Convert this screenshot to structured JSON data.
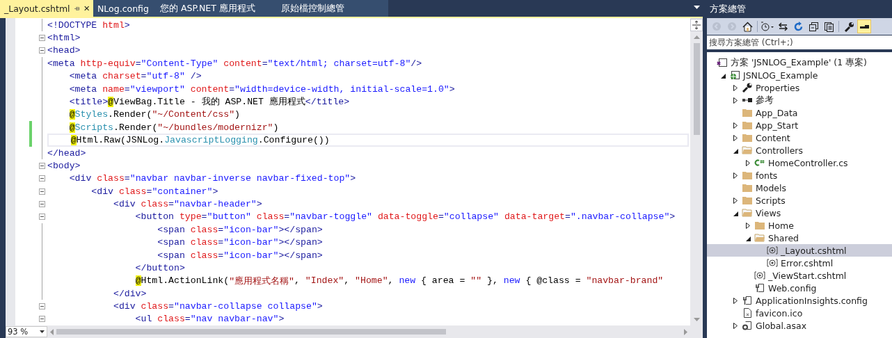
{
  "editor": {
    "tabs": [
      {
        "label": "_Layout.cshtml",
        "selected": true
      },
      {
        "label": "NLog.config",
        "selected": false
      },
      {
        "label": "您的 ASP.NET 應用程式",
        "selected": false
      },
      {
        "label": "原始檔控制總管",
        "selected": false
      }
    ],
    "lines": [
      {
        "fold": false,
        "changed": false,
        "current": false,
        "tokens": [
          {
            "kind": "tag",
            "text": "<!DOCTYPE"
          },
          {
            "kind": "attr",
            "text": " html"
          },
          {
            "kind": "tag",
            "text": ">"
          }
        ]
      },
      {
        "fold": true,
        "changed": false,
        "current": false,
        "tokens": [
          {
            "kind": "tag",
            "text": "<html>"
          }
        ]
      },
      {
        "fold": true,
        "changed": false,
        "current": false,
        "tokens": [
          {
            "kind": "tag",
            "text": "<head>"
          }
        ]
      },
      {
        "fold": false,
        "changed": false,
        "current": false,
        "tokens": [
          {
            "kind": "tag",
            "text": "<meta"
          },
          {
            "kind": "attr",
            "text": " http-equiv"
          },
          {
            "kind": "tag",
            "text": "="
          },
          {
            "kind": "value",
            "text": "\"Content-Type\""
          },
          {
            "kind": "attr",
            "text": " content"
          },
          {
            "kind": "tag",
            "text": "="
          },
          {
            "kind": "value",
            "text": "\"text/html; charset=utf-8\""
          },
          {
            "kind": "tag",
            "text": "/>"
          }
        ]
      },
      {
        "fold": false,
        "changed": false,
        "current": false,
        "tokens": [
          {
            "kind": "tag",
            "text": "    <meta"
          },
          {
            "kind": "attr",
            "text": " charset"
          },
          {
            "kind": "tag",
            "text": "="
          },
          {
            "kind": "value",
            "text": "\"utf-8\""
          },
          {
            "kind": "tag",
            "text": " />"
          }
        ]
      },
      {
        "fold": false,
        "changed": false,
        "current": false,
        "tokens": [
          {
            "kind": "tag",
            "text": "    <meta"
          },
          {
            "kind": "attr",
            "text": " name"
          },
          {
            "kind": "tag",
            "text": "="
          },
          {
            "kind": "value",
            "text": "\"viewport\""
          },
          {
            "kind": "attr",
            "text": " content"
          },
          {
            "kind": "tag",
            "text": "="
          },
          {
            "kind": "value",
            "text": "\"width=device-width, initial-scale=1.0\""
          },
          {
            "kind": "tag",
            "text": ">"
          }
        ]
      },
      {
        "fold": false,
        "changed": false,
        "current": false,
        "tokens": [
          {
            "kind": "tag",
            "text": "    <title>"
          },
          {
            "kind": "at",
            "text": "@"
          },
          {
            "kind": "text",
            "text": "ViewBag.Title"
          },
          {
            "kind": "text",
            "text": " - 我的 ASP.NET 應用程式"
          },
          {
            "kind": "tag",
            "text": "</title>"
          }
        ]
      },
      {
        "fold": false,
        "changed": false,
        "current": false,
        "tokens": [
          {
            "kind": "at",
            "text": "    @"
          },
          {
            "kind": "type",
            "text": "Styles"
          },
          {
            "kind": "text",
            "text": ".Render("
          },
          {
            "kind": "string",
            "text": "\"~/Content/css\""
          },
          {
            "kind": "text",
            "text": ")"
          }
        ]
      },
      {
        "fold": false,
        "changed": true,
        "current": false,
        "tokens": [
          {
            "kind": "at",
            "text": "    @"
          },
          {
            "kind": "type",
            "text": "Scripts"
          },
          {
            "kind": "text",
            "text": ".Render("
          },
          {
            "kind": "string",
            "text": "\"~/bundles/modernizr\""
          },
          {
            "kind": "text",
            "text": ")"
          }
        ]
      },
      {
        "fold": false,
        "changed": true,
        "current": true,
        "tokens": [
          {
            "kind": "at",
            "text": "    @"
          },
          {
            "kind": "text",
            "text": "Html.Raw(JSNLog."
          },
          {
            "kind": "type",
            "text": "JavascriptLogging"
          },
          {
            "kind": "text",
            "text": ".Configure())"
          }
        ]
      },
      {
        "fold": false,
        "changed": false,
        "current": false,
        "tokens": [
          {
            "kind": "tag",
            "text": "</head>"
          }
        ]
      },
      {
        "fold": true,
        "changed": false,
        "current": false,
        "tokens": [
          {
            "kind": "tag",
            "text": "<body>"
          }
        ]
      },
      {
        "fold": true,
        "changed": false,
        "current": false,
        "tokens": [
          {
            "kind": "tag",
            "text": "    <div"
          },
          {
            "kind": "attr",
            "text": " class"
          },
          {
            "kind": "tag",
            "text": "="
          },
          {
            "kind": "value",
            "text": "\"navbar navbar-inverse navbar-fixed-top\""
          },
          {
            "kind": "tag",
            "text": ">"
          }
        ]
      },
      {
        "fold": true,
        "changed": false,
        "current": false,
        "tokens": [
          {
            "kind": "tag",
            "text": "        <div"
          },
          {
            "kind": "attr",
            "text": " class"
          },
          {
            "kind": "tag",
            "text": "="
          },
          {
            "kind": "value",
            "text": "\"container\""
          },
          {
            "kind": "tag",
            "text": ">"
          }
        ]
      },
      {
        "fold": true,
        "changed": false,
        "current": false,
        "tokens": [
          {
            "kind": "tag",
            "text": "            <div"
          },
          {
            "kind": "attr",
            "text": " class"
          },
          {
            "kind": "tag",
            "text": "="
          },
          {
            "kind": "value",
            "text": "\"navbar-header\""
          },
          {
            "kind": "tag",
            "text": ">"
          }
        ]
      },
      {
        "fold": true,
        "changed": false,
        "current": false,
        "tokens": [
          {
            "kind": "tag",
            "text": "                <button"
          },
          {
            "kind": "attr",
            "text": " type"
          },
          {
            "kind": "tag",
            "text": "="
          },
          {
            "kind": "value",
            "text": "\"button\""
          },
          {
            "kind": "attr",
            "text": " class"
          },
          {
            "kind": "tag",
            "text": "="
          },
          {
            "kind": "value",
            "text": "\"navbar-toggle\""
          },
          {
            "kind": "attr",
            "text": " data-toggle"
          },
          {
            "kind": "tag",
            "text": "="
          },
          {
            "kind": "value",
            "text": "\"collapse\""
          },
          {
            "kind": "attr",
            "text": " data-target"
          },
          {
            "kind": "tag",
            "text": "="
          },
          {
            "kind": "value",
            "text": "\".navbar-collapse\""
          },
          {
            "kind": "tag",
            "text": ">"
          }
        ]
      },
      {
        "fold": false,
        "changed": false,
        "current": false,
        "tokens": [
          {
            "kind": "tag",
            "text": "                    <span"
          },
          {
            "kind": "attr",
            "text": " class"
          },
          {
            "kind": "tag",
            "text": "="
          },
          {
            "kind": "value",
            "text": "\"icon-bar\""
          },
          {
            "kind": "tag",
            "text": "></span>"
          }
        ]
      },
      {
        "fold": false,
        "changed": false,
        "current": false,
        "tokens": [
          {
            "kind": "tag",
            "text": "                    <span"
          },
          {
            "kind": "attr",
            "text": " class"
          },
          {
            "kind": "tag",
            "text": "="
          },
          {
            "kind": "value",
            "text": "\"icon-bar\""
          },
          {
            "kind": "tag",
            "text": "></span>"
          }
        ]
      },
      {
        "fold": false,
        "changed": false,
        "current": false,
        "tokens": [
          {
            "kind": "tag",
            "text": "                    <span"
          },
          {
            "kind": "attr",
            "text": " class"
          },
          {
            "kind": "tag",
            "text": "="
          },
          {
            "kind": "value",
            "text": "\"icon-bar\""
          },
          {
            "kind": "tag",
            "text": "></span>"
          }
        ]
      },
      {
        "fold": false,
        "changed": false,
        "current": false,
        "tokens": [
          {
            "kind": "tag",
            "text": "                </button>"
          }
        ]
      },
      {
        "fold": false,
        "changed": false,
        "current": false,
        "tokens": [
          {
            "kind": "at",
            "text": "                @"
          },
          {
            "kind": "text",
            "text": "Html.ActionLink("
          },
          {
            "kind": "string",
            "text": "\"應用程式名稱\""
          },
          {
            "kind": "text",
            "text": ", "
          },
          {
            "kind": "string",
            "text": "\"Index\""
          },
          {
            "kind": "text",
            "text": ", "
          },
          {
            "kind": "string",
            "text": "\"Home\""
          },
          {
            "kind": "text",
            "text": ", "
          },
          {
            "kind": "keyword",
            "text": "new"
          },
          {
            "kind": "text",
            "text": " { area = "
          },
          {
            "kind": "string",
            "text": "\"\""
          },
          {
            "kind": "text",
            "text": " }, "
          },
          {
            "kind": "keyword",
            "text": "new"
          },
          {
            "kind": "text",
            "text": " { @class = "
          },
          {
            "kind": "string",
            "text": "\"navbar-brand\""
          }
        ]
      },
      {
        "fold": false,
        "changed": false,
        "current": false,
        "tokens": [
          {
            "kind": "tag",
            "text": "            </div>"
          }
        ]
      },
      {
        "fold": true,
        "changed": false,
        "current": false,
        "tokens": [
          {
            "kind": "tag",
            "text": "            <div"
          },
          {
            "kind": "attr",
            "text": " class"
          },
          {
            "kind": "tag",
            "text": "="
          },
          {
            "kind": "value",
            "text": "\"navbar-collapse collapse\""
          },
          {
            "kind": "tag",
            "text": ">"
          }
        ]
      },
      {
        "fold": true,
        "changed": false,
        "current": false,
        "tokens": [
          {
            "kind": "tag",
            "text": "                <ul"
          },
          {
            "kind": "attr",
            "text": " class"
          },
          {
            "kind": "tag",
            "text": "="
          },
          {
            "kind": "value",
            "text": "\"nav navbar-nav\""
          },
          {
            "kind": "tag",
            "text": ">"
          }
        ]
      }
    ],
    "zoom": "93 %"
  },
  "solution_explorer": {
    "title": "方案總管",
    "toolbar": [
      {
        "kind": "back",
        "disabled": true
      },
      {
        "kind": "forward",
        "disabled": true
      },
      {
        "kind": "home",
        "disabled": false
      },
      {
        "kind": "separator"
      },
      {
        "kind": "history",
        "disabled": false
      },
      {
        "kind": "sync",
        "disabled": false
      },
      {
        "kind": "refresh",
        "disabled": false
      },
      {
        "kind": "collapse",
        "disabled": false
      },
      {
        "kind": "show-all",
        "disabled": false
      },
      {
        "kind": "separator"
      },
      {
        "kind": "properties",
        "disabled": false
      },
      {
        "kind": "preview",
        "disabled": false,
        "on": true
      }
    ],
    "search": {
      "placeholder": "搜尋方案總管 (Ctrl+;)"
    },
    "tree": [
      {
        "label": "方案 'JSNLOG_Example' (1 專案)",
        "kind": "solution",
        "selected": false,
        "children": [
          {
            "label": "JSNLOG_Example",
            "kind": "web-project",
            "expanded": true,
            "selected": false,
            "children": [
              {
                "label": "Properties",
                "kind": "wrench",
                "expanded": false,
                "selected": false
              },
              {
                "label": "參考",
                "kind": "references",
                "expanded": false,
                "selected": false
              },
              {
                "label": "App_Data",
                "kind": "folder",
                "selected": false
              },
              {
                "label": "App_Start",
                "kind": "folder",
                "expanded": false,
                "selected": false
              },
              {
                "label": "Content",
                "kind": "folder",
                "expanded": false,
                "selected": false
              },
              {
                "label": "Controllers",
                "kind": "folder",
                "expanded": true,
                "selected": false,
                "children": [
                  {
                    "label": "HomeController.cs",
                    "kind": "csharp",
                    "expanded": false,
                    "selected": false
                  }
                ]
              },
              {
                "label": "fonts",
                "kind": "folder",
                "expanded": false,
                "selected": false
              },
              {
                "label": "Models",
                "kind": "folder",
                "selected": false
              },
              {
                "label": "Scripts",
                "kind": "folder",
                "expanded": false,
                "selected": false
              },
              {
                "label": "Views",
                "kind": "folder",
                "expanded": true,
                "selected": false,
                "children": [
                  {
                    "label": "Home",
                    "kind": "folder",
                    "expanded": false,
                    "selected": false
                  },
                  {
                    "label": "Shared",
                    "kind": "folder",
                    "expanded": true,
                    "selected": false,
                    "children": [
                      {
                        "label": "_Layout.cshtml",
                        "kind": "razor",
                        "selected": true
                      },
                      {
                        "label": "Error.cshtml",
                        "kind": "razor",
                        "selected": false
                      }
                    ]
                  },
                  {
                    "label": "_ViewStart.cshtml",
                    "kind": "razor",
                    "selected": false
                  },
                  {
                    "label": "Web.config",
                    "kind": "config",
                    "selected": false
                  }
                ]
              },
              {
                "label": "ApplicationInsights.config",
                "kind": "config",
                "expanded": false,
                "selected": false
              },
              {
                "label": "favicon.ico",
                "kind": "file",
                "selected": false
              },
              {
                "label": "Global.asax",
                "kind": "asax",
                "expanded": false,
                "selected": false
              }
            ]
          }
        ]
      }
    ]
  }
}
